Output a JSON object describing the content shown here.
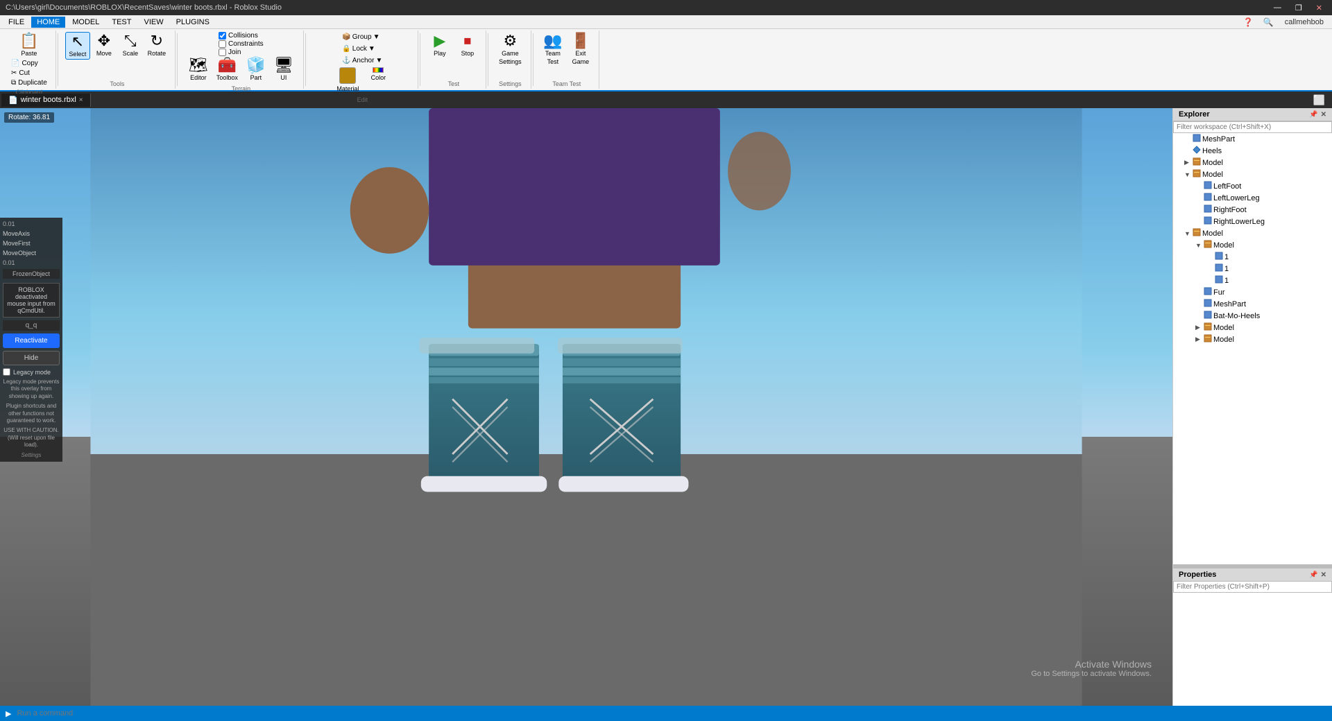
{
  "titlebar": {
    "path": "C:\\Users\\girl\\Documents\\ROBLOX\\RecentSaves\\winter boots.rbxl - Roblox Studio",
    "controls": [
      "—",
      "❐",
      "✕"
    ]
  },
  "menubar": {
    "items": [
      "FILE",
      "HOME",
      "MODEL",
      "TEST",
      "VIEW",
      "PLUGINS"
    ]
  },
  "ribbon": {
    "active_tab": "HOME",
    "tabs": [
      "FILE",
      "HOME",
      "MODEL",
      "TEST",
      "VIEW",
      "PLUGINS"
    ],
    "groups": [
      {
        "name": "Clipboard",
        "buttons": [
          {
            "label": "Paste",
            "icon": "📋"
          },
          {
            "label": "Copy",
            "icon": "📄"
          },
          {
            "label": "Cut",
            "icon": "✂"
          },
          {
            "label": "Duplicate",
            "icon": "⧉"
          }
        ]
      },
      {
        "name": "Tools",
        "buttons": [
          {
            "label": "Select",
            "icon": "↖"
          },
          {
            "label": "Move",
            "icon": "✥"
          },
          {
            "label": "Scale",
            "icon": "⤡"
          },
          {
            "label": "Rotate",
            "icon": "↻"
          }
        ]
      },
      {
        "name": "Terrain",
        "checkboxes": [
          "Collisions",
          "Constraints",
          "Join"
        ],
        "sub_buttons": [
          "Editor",
          "Toolbox",
          "Part",
          "UI"
        ]
      },
      {
        "name": "Edit",
        "buttons": [
          {
            "label": "Material",
            "icon": "🟫"
          },
          {
            "label": "Color",
            "icon": "🎨"
          },
          {
            "label": "Lock",
            "icon": "🔒"
          },
          {
            "label": "Anchor",
            "icon": "⚓"
          }
        ],
        "group_sub": [
          "Group",
          "Lock",
          "Anchor"
        ]
      },
      {
        "name": "Test",
        "buttons": [
          {
            "label": "Play",
            "icon": "▶"
          },
          {
            "label": "Stop",
            "icon": "⏹"
          }
        ]
      },
      {
        "name": "Settings",
        "buttons": [
          {
            "label": "Game Settings",
            "icon": "⚙"
          }
        ]
      },
      {
        "name": "Team Test",
        "buttons": [
          {
            "label": "Team Test",
            "icon": "👥"
          },
          {
            "label": "Exit Game",
            "icon": "🚪"
          }
        ]
      }
    ]
  },
  "editor_tab": {
    "filename": "winter boots.rbxl",
    "close": "×"
  },
  "viewport": {
    "rotate_label": "Rotate: 36.81",
    "activate_msg": "Activate Windows",
    "activate_sub": "Go to Settings to activate Windows."
  },
  "left_panel": {
    "val1": "0.01",
    "moveaxis": "MoveAxis",
    "movefirst": "MoveFirst",
    "moveobject": "MoveObject",
    "val2": "0.01",
    "frozenobject": "FrozenObject",
    "deactivated_msg": "ROBLOX deactivated mouse input from qCmdUtil.",
    "qq": "q_q",
    "reactivate_label": "Reactivate",
    "hide_label": "Hide",
    "legacy_label": "Legacy mode",
    "legacy_desc": "Legacy mode prevents this overlay from showing up again.",
    "plugin_shortcuts": "Plugin shortcuts and other functions not guaranteed to work.",
    "use_caution": "USE WITH CAUTION. (Will reset upon file load).",
    "settings_label": "Settings"
  },
  "explorer": {
    "title": "Explorer",
    "filter_placeholder": "Filter workspace (Ctrl+Shift+X)",
    "tree": [
      {
        "label": "MeshPart",
        "indent": 1,
        "has_arrow": false,
        "icon": "⬜"
      },
      {
        "label": "Heels",
        "indent": 1,
        "has_arrow": false,
        "icon": "🔷"
      },
      {
        "label": "Model",
        "indent": 1,
        "has_arrow": true,
        "icon": "📦"
      },
      {
        "label": "Model",
        "indent": 1,
        "has_arrow": true,
        "open": true,
        "icon": "📦"
      },
      {
        "label": "LeftFoot",
        "indent": 2,
        "has_arrow": false,
        "icon": "⬜"
      },
      {
        "label": "LeftLowerLeg",
        "indent": 2,
        "has_arrow": false,
        "icon": "⬜"
      },
      {
        "label": "RightFoot",
        "indent": 2,
        "has_arrow": false,
        "icon": "⬜"
      },
      {
        "label": "RightLowerLeg",
        "indent": 2,
        "has_arrow": false,
        "icon": "⬜"
      },
      {
        "label": "Model",
        "indent": 1,
        "has_arrow": true,
        "open": true,
        "icon": "📦"
      },
      {
        "label": "Model",
        "indent": 2,
        "has_arrow": true,
        "open": true,
        "icon": "📦"
      },
      {
        "label": "1",
        "indent": 3,
        "has_arrow": false,
        "icon": "⬜"
      },
      {
        "label": "1",
        "indent": 3,
        "has_arrow": false,
        "icon": "⬜"
      },
      {
        "label": "1",
        "indent": 3,
        "has_arrow": false,
        "icon": "⬜"
      },
      {
        "label": "Fur",
        "indent": 2,
        "has_arrow": false,
        "icon": "⬜"
      },
      {
        "label": "MeshPart",
        "indent": 2,
        "has_arrow": false,
        "icon": "⬜"
      },
      {
        "label": "Bat-Mo-Heels",
        "indent": 2,
        "has_arrow": false,
        "icon": "⬜"
      },
      {
        "label": "Model",
        "indent": 2,
        "has_arrow": true,
        "icon": "📦"
      },
      {
        "label": "Model",
        "indent": 2,
        "has_arrow": true,
        "icon": "📦"
      }
    ]
  },
  "properties": {
    "title": "Properties",
    "filter_placeholder": "Filter Properties (Ctrl+Shift+P)"
  },
  "statusbar": {
    "run_placeholder": "Run a command"
  },
  "user": {
    "name": "callmehbob"
  }
}
